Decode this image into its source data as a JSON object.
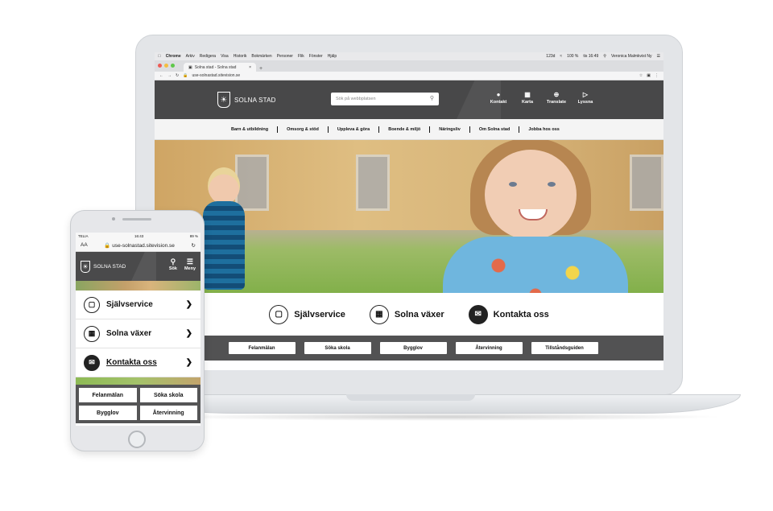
{
  "mac_menu": {
    "items": [
      "Chrome",
      "Arkiv",
      "Redigera",
      "Visa",
      "Historik",
      "Bokmärken",
      "Personer",
      "Flik",
      "Fönster",
      "Hjälp"
    ],
    "status": [
      "123d",
      "100 %",
      "tis 16:49",
      "Veronica Malmkvist Ny"
    ]
  },
  "browser": {
    "tab_title": "Solna stad - Solna stad",
    "url": "use-solnastad.sitevision.se"
  },
  "site": {
    "brand": "SOLNA STAD",
    "search_placeholder": "Sök på webbplatsen",
    "header_icons": [
      {
        "icon": "chat-bubble-icon",
        "label": "Kontakt"
      },
      {
        "icon": "map-icon",
        "label": "Karta"
      },
      {
        "icon": "globe-icon",
        "label": "Translate"
      },
      {
        "icon": "speaker-icon",
        "label": "Lyssna"
      }
    ],
    "nav": [
      "Barn & utbildning",
      "Omsorg & stöd",
      "Uppleva & göra",
      "Boende & miljö",
      "Näringsliv",
      "Om Solna stad",
      "Jobba hos oss"
    ],
    "quick_links": [
      {
        "icon": "monitor-icon",
        "label": "Självservice"
      },
      {
        "icon": "buildings-icon",
        "label": "Solna växer"
      },
      {
        "icon": "envelope-icon",
        "label": "Kontakta oss"
      }
    ],
    "buttons": [
      "Felanmälan",
      "Söka skola",
      "Bygglov",
      "Återvinning",
      "Tillståndsguiden"
    ]
  },
  "phone": {
    "carrier": "TELIA",
    "time": "16:43",
    "battery": "89 %",
    "text_size": "AA",
    "url": "use-solnastad.sitevision.se",
    "brand": "SOLNA STAD",
    "search_label": "Sök",
    "menu_label": "Meny",
    "items": [
      {
        "icon": "monitor-icon",
        "label": "Självservice"
      },
      {
        "icon": "buildings-icon",
        "label": "Solna växer"
      },
      {
        "icon": "envelope-icon",
        "label": "Kontakta oss"
      }
    ],
    "buttons": [
      "Felanmälan",
      "Söka skola",
      "Bygglov",
      "Återvinning"
    ]
  }
}
